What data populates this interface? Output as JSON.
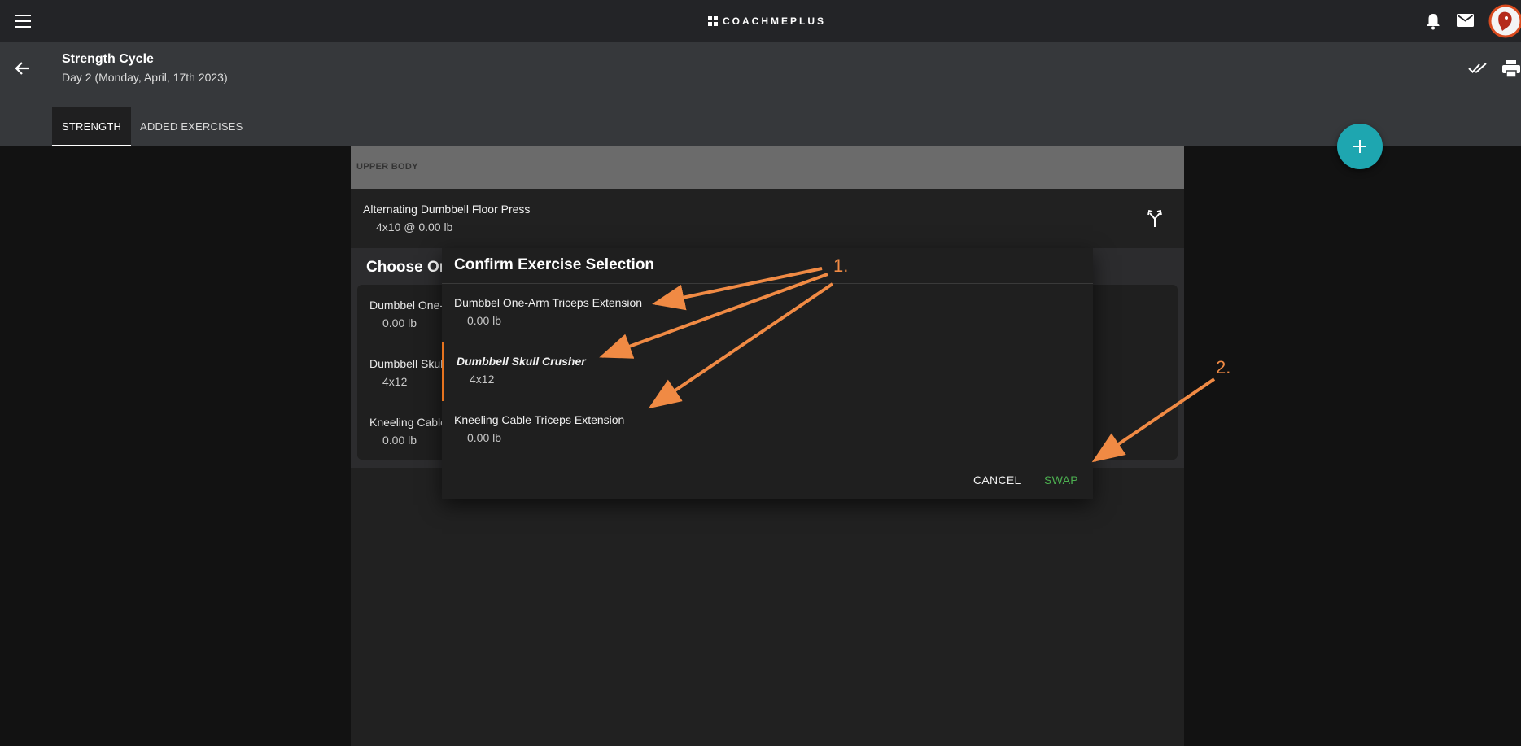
{
  "app": {
    "brand": "COACHMEPLUS",
    "menu_icon": "hamburger-menu-icon",
    "notifications_icon": "bell-icon",
    "mail_icon": "mail-icon",
    "avatar_icon": "avatar-icon"
  },
  "header": {
    "title": "Strength Cycle",
    "subtitle": "Day 2 (Monday, April, 17th 2023)",
    "back_icon": "arrow-left-icon",
    "check_icon": "double-check-icon",
    "print_icon": "printer-icon"
  },
  "tabs": [
    {
      "label": "STRENGTH",
      "active": true
    },
    {
      "label": "ADDED EXERCISES",
      "active": false
    }
  ],
  "fab": {
    "icon": "plus-icon"
  },
  "workout": {
    "section_label": "UPPER BODY",
    "exercise": {
      "name": "Alternating Dumbbell Floor Press",
      "detail": "4x10  @ 0.00 lb",
      "swap_icon": "fork-swap-icon"
    }
  },
  "choose_panel": {
    "title": "Choose On",
    "items": [
      {
        "name": "Dumbbel One-",
        "detail": "0.00 lb"
      },
      {
        "name": "Dumbbell Skul",
        "detail": "4x12"
      },
      {
        "name": "Kneeling Cable",
        "detail": "0.00 lb"
      }
    ]
  },
  "dialog": {
    "title": "Confirm Exercise Selection",
    "options": [
      {
        "name": "Dumbbel One-Arm Triceps Extension",
        "detail": "0.00 lb",
        "selected": false
      },
      {
        "name": "Dumbbell Skull Crusher",
        "detail": "4x12",
        "selected": true
      },
      {
        "name": "Kneeling Cable Triceps Extension",
        "detail": "0.00 lb",
        "selected": false
      }
    ],
    "cancel_label": "CANCEL",
    "swap_label": "SWAP"
  },
  "annotations": {
    "label_1": "1.",
    "label_2": "2.",
    "color": "#f08a44"
  },
  "colors": {
    "accent_teal": "#1ea6b0",
    "selection_orange": "#e6731f",
    "swap_green": "#4caf50"
  }
}
